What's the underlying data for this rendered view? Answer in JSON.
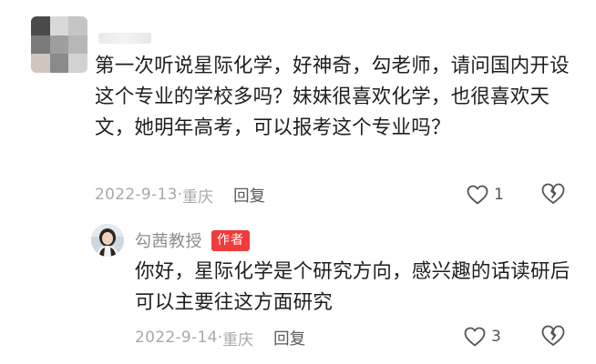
{
  "comment": {
    "text": "第一次听说星际化学，好神奇，勾老师，请问国内开设这个专业的学校多吗？妹妹很喜欢化学，也很喜欢天文，她明年高考，可以报考这个专业吗？",
    "date": "2022-9-13",
    "location_sep": "·",
    "location": "重庆",
    "reply_label": "回复",
    "like_count": "1",
    "like_icon": "heart-outline-icon",
    "dislike_icon": "broken-heart-icon"
  },
  "reply": {
    "author": "勾茜教授",
    "badge": "作者",
    "text": "你好，星际化学是个研究方向，感兴趣的话读研后可以主要往这方面研究",
    "date": "2022-9-14",
    "location_sep": "·",
    "location": "重庆",
    "reply_label": "回复",
    "like_count": "3",
    "like_icon": "heart-outline-icon",
    "dislike_icon": "broken-heart-icon"
  },
  "colors": {
    "badge": "#ef3b3b",
    "meta": "#a9a9a9",
    "text": "#1e1e1e"
  }
}
